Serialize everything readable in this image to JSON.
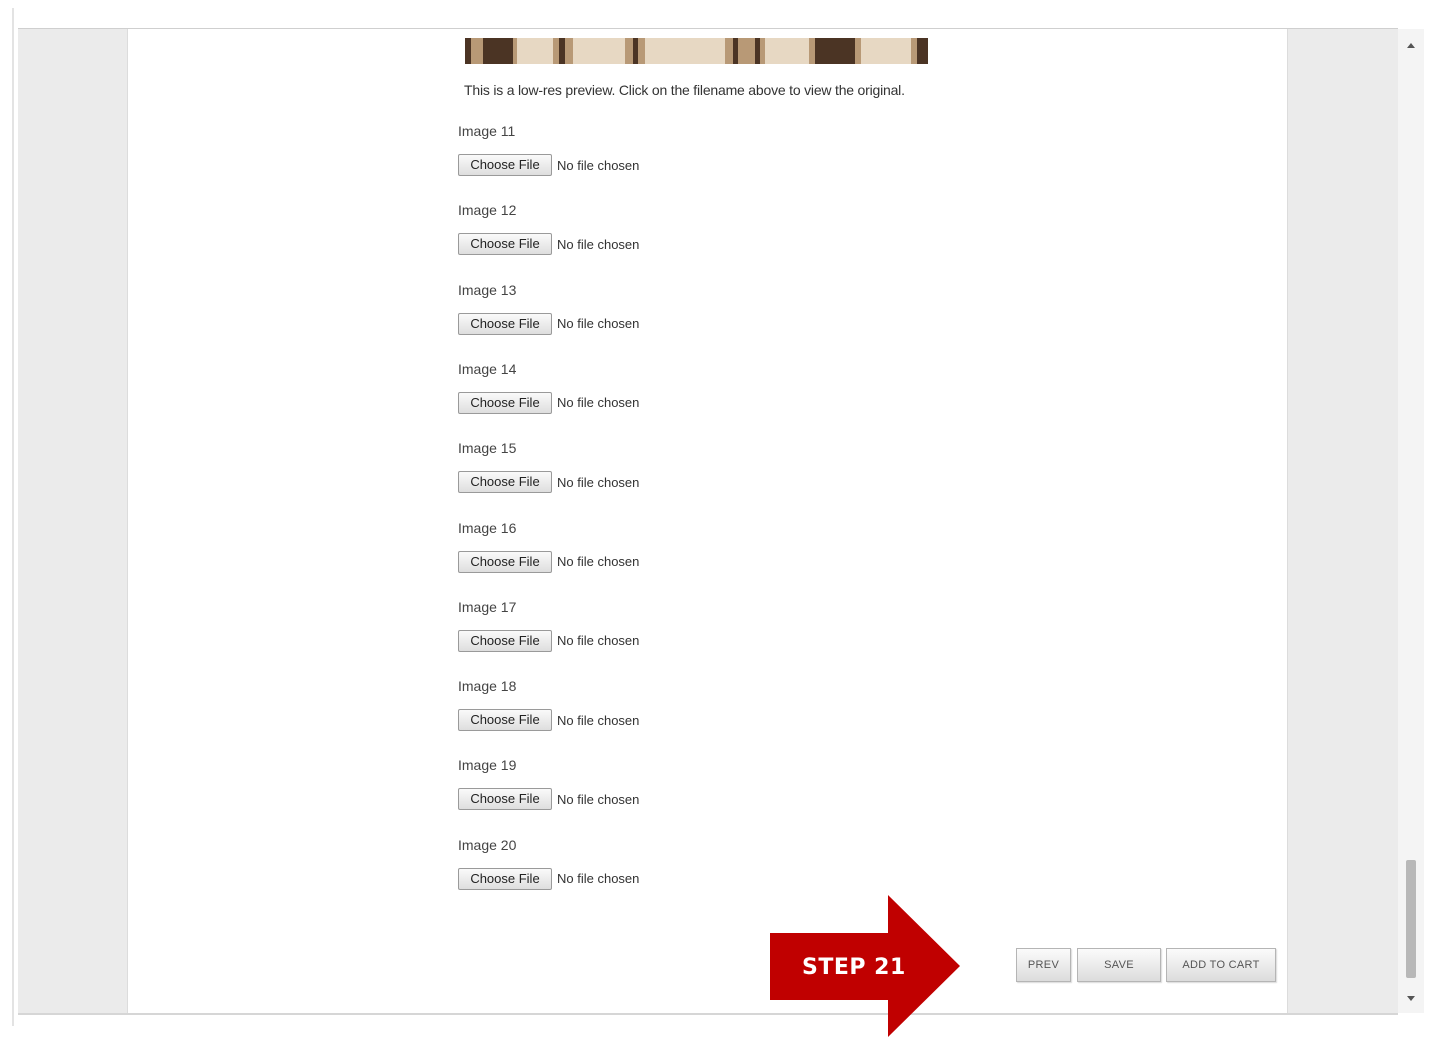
{
  "preview": {
    "caption": "This is a low-res preview. Click on the filename above to view the original."
  },
  "upload_fields": [
    {
      "label": "Image 11",
      "button": "Choose File",
      "status": "No file chosen"
    },
    {
      "label": "Image 12",
      "button": "Choose File",
      "status": "No file chosen"
    },
    {
      "label": "Image 13",
      "button": "Choose File",
      "status": "No file chosen"
    },
    {
      "label": "Image 14",
      "button": "Choose File",
      "status": "No file chosen"
    },
    {
      "label": "Image 15",
      "button": "Choose File",
      "status": "No file chosen"
    },
    {
      "label": "Image 16",
      "button": "Choose File",
      "status": "No file chosen"
    },
    {
      "label": "Image 17",
      "button": "Choose File",
      "status": "No file chosen"
    },
    {
      "label": "Image 18",
      "button": "Choose File",
      "status": "No file chosen"
    },
    {
      "label": "Image 19",
      "button": "Choose File",
      "status": "No file chosen"
    },
    {
      "label": "Image 20",
      "button": "Choose File",
      "status": "No file chosen"
    }
  ],
  "actions": {
    "prev": "PREV",
    "save": "SAVE",
    "add_to_cart": "ADD TO CART"
  },
  "annotation": {
    "step_label": "STEP 21",
    "color": "#c00000"
  },
  "colors": {
    "gutter": "#ebebeb",
    "button_border": "#9a9a9a"
  }
}
